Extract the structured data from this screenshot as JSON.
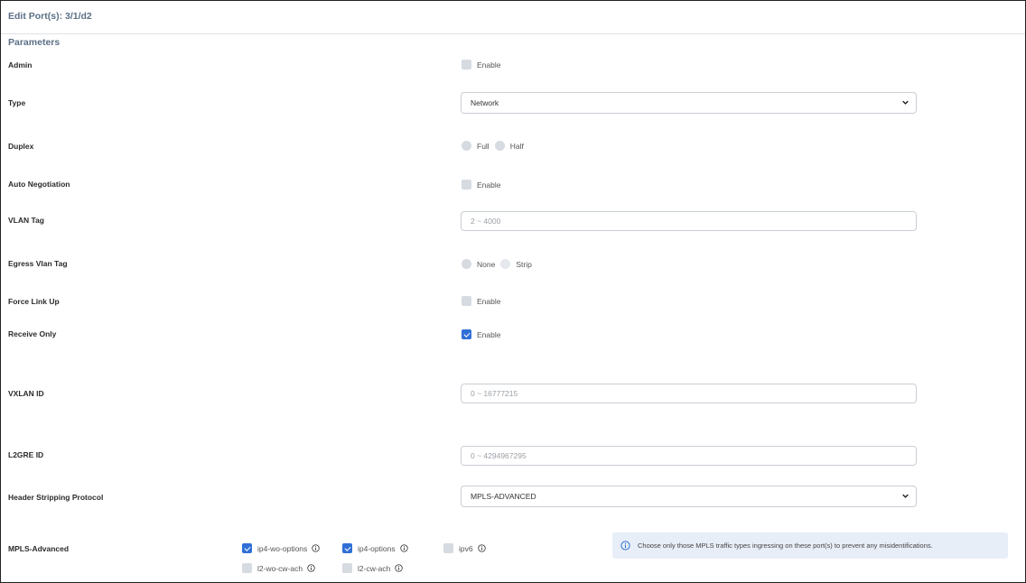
{
  "header": {
    "title": "Edit Port(s): 3/1/d2"
  },
  "section": {
    "title": "Parameters"
  },
  "fields": {
    "admin": {
      "label": "Admin",
      "option": "Enable",
      "checked": false
    },
    "type": {
      "label": "Type",
      "value": "Network"
    },
    "duplex": {
      "label": "Duplex",
      "options": [
        "Full",
        "Half"
      ]
    },
    "auto_negotiation": {
      "label": "Auto Negotiation",
      "option": "Enable",
      "checked": false
    },
    "vlan_tag": {
      "label": "VLAN Tag",
      "placeholder": "2 ~ 4000"
    },
    "egress_vlan_tag": {
      "label": "Egress Vlan Tag",
      "options": [
        "None",
        "Strip"
      ]
    },
    "force_link_up": {
      "label": "Force Link Up",
      "option": "Enable",
      "checked": false
    },
    "receive_only": {
      "label": "Receive Only",
      "option": "Enable",
      "checked": true
    },
    "vxlan_id": {
      "label": "VXLAN ID",
      "placeholder": "0 ~ 16777215"
    },
    "l2gre_id": {
      "label": "L2GRE ID",
      "placeholder": "0 ~ 4294967295"
    },
    "header_stripping": {
      "label": "Header Stripping Protocol",
      "value": "MPLS-ADVANCED"
    },
    "mpls_advanced": {
      "label": "MPLS-Advanced",
      "options": [
        {
          "label": "ip4-wo-options",
          "checked": true
        },
        {
          "label": "ip4-options",
          "checked": true
        },
        {
          "label": "ipv6",
          "checked": false
        },
        {
          "label": "l2-wo-cw-ach",
          "checked": false
        },
        {
          "label": "l2-cw-ach",
          "checked": false
        }
      ],
      "info_text": "Choose only those MPLS traffic types ingressing on these port(s) to prevent any misidentifications."
    }
  },
  "colors": {
    "accent": "#2f6fd6",
    "info_bg": "#e8eef8",
    "title": "#5b6f86"
  },
  "icons": {
    "chevron": "chevron-down-icon",
    "info": "info-icon"
  }
}
